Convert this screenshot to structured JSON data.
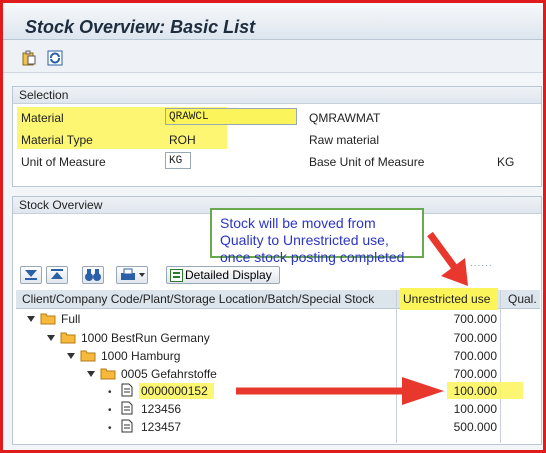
{
  "window": {
    "title": "Stock Overview: Basic List"
  },
  "toolbar": {
    "icons": [
      "clipboard-icon",
      "refresh-icon"
    ]
  },
  "selection": {
    "header": "Selection",
    "material_label": "Material",
    "material_value": "QRAWCL",
    "material_desc": "QMRAWMAT",
    "material_type_label": "Material Type",
    "material_type_value": "ROH",
    "material_type_desc": "Raw material",
    "uom_label": "Unit of Measure",
    "uom_value": "KG",
    "base_uom_label": "Base Unit of Measure",
    "base_uom_value": "KG"
  },
  "stock_overview": {
    "header": "Stock Overview",
    "annotation_line1": "Stock will be moved from Quality to Unrestricted use,",
    "annotation_line2": "once stock posting completed",
    "detailed_display_label": "Detailed Display",
    "columns": {
      "hierarchy": "Client/Company Code/Plant/Storage Location/Batch/Special Stock",
      "unrestricted": "Unrestricted use",
      "qual": "Qual."
    },
    "rows": [
      {
        "label": "Full",
        "value": "700.000"
      },
      {
        "label": "1000 BestRun Germany",
        "value": "700.000"
      },
      {
        "label": "1000 Hamburg",
        "value": "700.000"
      },
      {
        "label": "0005 Gefahrstoffe",
        "value": "700.000"
      },
      {
        "label": "0000000152",
        "value": "100.000"
      },
      {
        "label": "123456",
        "value": "100.000"
      },
      {
        "label": "123457",
        "value": "500.000"
      }
    ]
  },
  "colors": {
    "highlight": "#fbf45a",
    "arrow": "#e8372c",
    "frame": "#e01b1b",
    "annotation_text": "#2a35c4",
    "annotation_border": "#6aa84f"
  }
}
